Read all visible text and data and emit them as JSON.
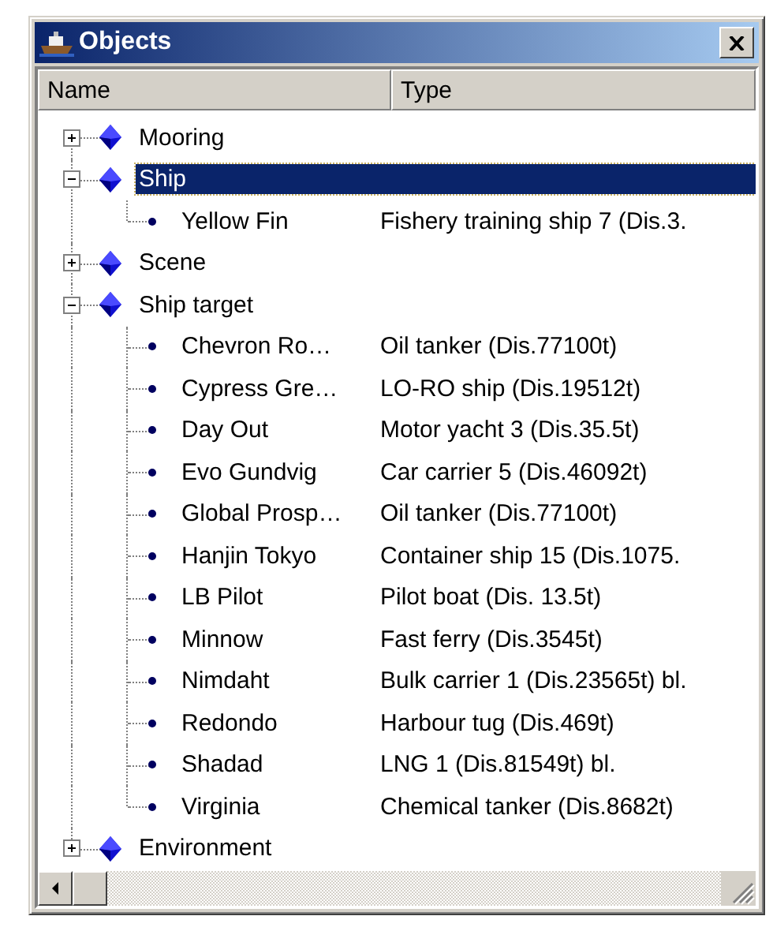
{
  "window": {
    "title": "Objects"
  },
  "columns": [
    "Name",
    "Type"
  ],
  "tree": [
    {
      "name": "Mooring",
      "expanded": false,
      "selected": false
    },
    {
      "name": "Ship",
      "expanded": true,
      "selected": true,
      "children": [
        {
          "name": "Yellow Fin",
          "type": "Fishery training ship 7 (Dis.3.",
          "selected": false
        }
      ]
    },
    {
      "name": "Scene",
      "expanded": false,
      "selected": false
    },
    {
      "name": "Ship target",
      "expanded": true,
      "selected": false,
      "children": [
        {
          "name": "Chevron Ro…",
          "type": "Oil tanker (Dis.77100t)",
          "selected": false
        },
        {
          "name": "Cypress Gre…",
          "type": "LO-RO ship (Dis.19512t)",
          "selected": false
        },
        {
          "name": "Day Out",
          "type": "Motor yacht 3 (Dis.35.5t)",
          "selected": false
        },
        {
          "name": "Evo Gundvig",
          "type": "Car carrier 5 (Dis.46092t)",
          "selected": false
        },
        {
          "name": "Global Prosp…",
          "type": "Oil tanker (Dis.77100t)",
          "selected": false
        },
        {
          "name": "Hanjin Tokyo",
          "type": "Container ship 15 (Dis.1075.",
          "selected": false
        },
        {
          "name": "LB Pilot",
          "type": "Pilot boat (Dis. 13.5t)",
          "selected": false
        },
        {
          "name": "Minnow",
          "type": "Fast ferry (Dis.3545t)",
          "selected": false
        },
        {
          "name": "Nimdaht",
          "type": "Bulk carrier 1 (Dis.23565t) bl.",
          "selected": false
        },
        {
          "name": "Redondo",
          "type": "Harbour tug (Dis.469t)",
          "selected": false
        },
        {
          "name": "Shadad",
          "type": "LNG 1 (Dis.81549t) bl.",
          "selected": false
        },
        {
          "name": "Virginia",
          "type": "Chemical tanker (Dis.8682t)",
          "selected": false
        }
      ]
    },
    {
      "name": "Environment",
      "expanded": false,
      "selected": false
    }
  ]
}
